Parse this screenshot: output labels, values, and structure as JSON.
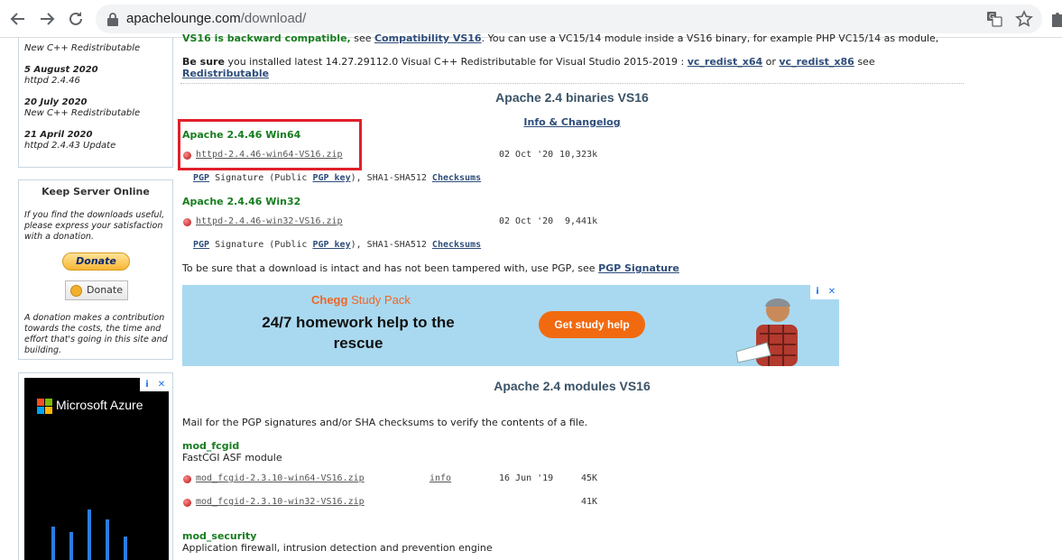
{
  "browser": {
    "url_host": "apachelounge.com",
    "url_path": "/download/"
  },
  "sidebar": {
    "news": [
      {
        "date": "",
        "text": "New C++ Redistributable"
      },
      {
        "date": "5 August 2020",
        "text": "httpd 2.4.46"
      },
      {
        "date": "20 July 2020",
        "text": "New C++ Redistributable"
      },
      {
        "date": "21 April 2020",
        "text": "httpd 2.4.43 Update"
      }
    ],
    "keep_title": "Keep Server Online",
    "keep_text": "If you find the downloads useful, please express your satisfaction with a donation.",
    "donate_paypal": "Donate",
    "donate_coin": "Donate",
    "donate_note": "A donation makes a contribution towards the costs, the time and effort that's going in this site and building.",
    "azure_ad": {
      "brand": "Microsoft Azure",
      "bars": [
        0.42,
        0.36,
        0.62,
        0.5,
        0.3
      ]
    }
  },
  "main": {
    "vs16_prefix": "VS16 is backward compatible,",
    "vs16_see": " see ",
    "vs16_link": "Compatibility VS16",
    "vs16_rest": ". You can use a VC15/14 module inside a VS16 binary, for example PHP VC15/14 as module,",
    "besure_bold": "Be sure",
    "besure_text": " you installed latest 14.27.29112.0 Visual C++ Redistributable for Visual Studio 2015-2019 : ",
    "vc_x64": "vc_redist_x64",
    "or": " or ",
    "vc_x86": "vc_redist_x86",
    "see": " see",
    "redistributable": "Redistributable",
    "binaries_title": "Apache 2.4 binaries VS16",
    "info_changelog": "Info & Changelog",
    "win64": {
      "title": "Apache 2.4.46 Win64",
      "file": "httpd-2.4.46-win64-VS16.zip",
      "date": "02 Oct '20",
      "size": "10,323k"
    },
    "win32": {
      "title": "Apache 2.4.46 Win32",
      "file": "httpd-2.4.46-win32-VS16.zip",
      "date": "02 Oct '20",
      "size": "9,441k"
    },
    "sig": {
      "pgp": "PGP",
      "signature_public": " Signature (Public ",
      "pgp_key": "PGP key",
      "sha": "), SHA1-SHA512 ",
      "checksums": "Checksums"
    },
    "tamper_text": "To be sure that a download is intact and has not been tampered with, use PGP, see ",
    "pgp_signature": "PGP Signature",
    "ad": {
      "brand": "Chegg",
      "pack": " Study Pack",
      "headline": "24/7 homework help to the rescue",
      "button": "Get study help"
    },
    "modules_title": "Apache 2.4 modules VS16",
    "mail_text": "Mail for the PGP signatures and/or SHA checksums to verify the contents of a file.",
    "fcgid": {
      "title": "mod_fcgid",
      "desc": "FastCGI ASF module",
      "files": [
        {
          "file": "mod_fcgid-2.3.10-win64-VS16.zip",
          "info": "info",
          "date": "16 Jun '19",
          "size": "45K"
        },
        {
          "file": "mod_fcgid-2.3.10-win32-VS16.zip",
          "info": "",
          "date": "",
          "size": "41K"
        }
      ]
    },
    "security": {
      "title": "mod_security",
      "desc": "Application firewall, intrusion detection and prevention engine"
    }
  }
}
